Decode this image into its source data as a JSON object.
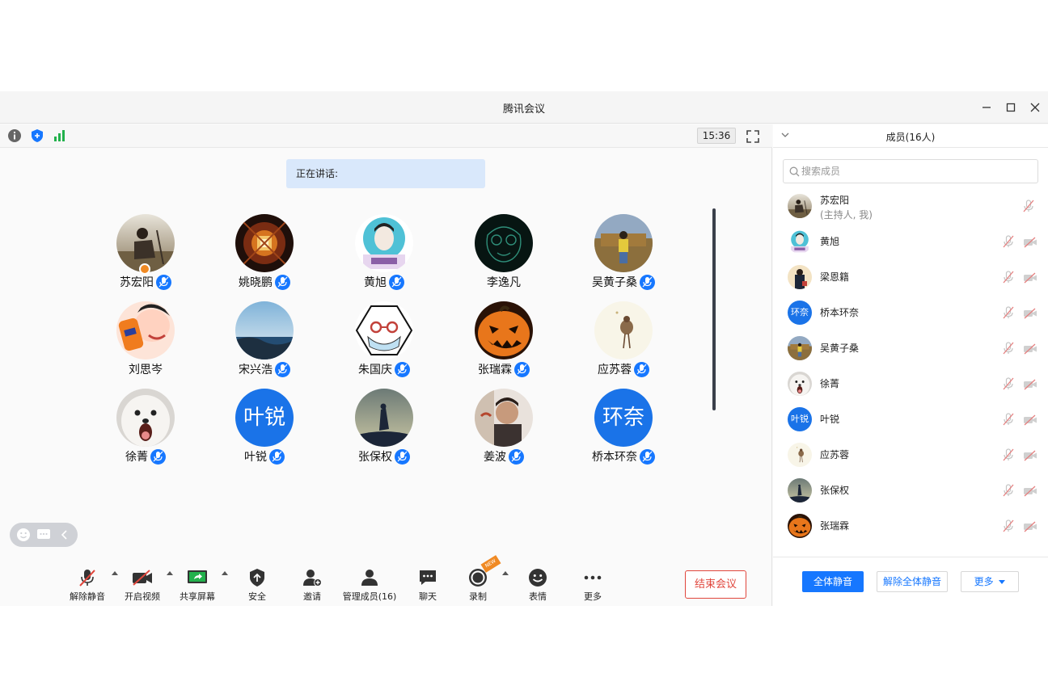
{
  "window": {
    "title": "腾讯会议"
  },
  "topbar": {
    "clock": "15:36"
  },
  "speaking": {
    "label": "正在讲话:"
  },
  "participants": [
    {
      "name": "苏宏阳"
    },
    {
      "name": "姚晓鹏"
    },
    {
      "name": "黄旭"
    },
    {
      "name": "李逸凡"
    },
    {
      "name": "吴黄子桑"
    },
    {
      "name": "刘思岑"
    },
    {
      "name": "宋兴浩"
    },
    {
      "name": "朱国庆"
    },
    {
      "name": "张瑞霖"
    },
    {
      "name": "应苏蓉"
    },
    {
      "name": "徐菁"
    },
    {
      "name": "叶锐",
      "avatar_text": "叶锐"
    },
    {
      "name": "张保权"
    },
    {
      "name": "姜波"
    },
    {
      "name": "桥本环奈",
      "avatar_text": "环奈"
    }
  ],
  "toolbar": {
    "unmute": "解除静音",
    "video": "开启视频",
    "share": "共享屏幕",
    "security": "安全",
    "invite": "邀请",
    "manage": "管理成员(16)",
    "chat": "聊天",
    "record": "录制",
    "emoji": "表情",
    "more": "更多",
    "end": "结束会议",
    "new_badge": "NEW"
  },
  "panel": {
    "title": "成员(16人)",
    "search_placeholder": "搜索成员",
    "members": [
      {
        "name": "苏宏阳",
        "sub": "(主持人, 我)"
      },
      {
        "name": "黄旭"
      },
      {
        "name": "梁恩籍"
      },
      {
        "name": "桥本环奈",
        "avatar_text": "环奈"
      },
      {
        "name": "吴黄子桑"
      },
      {
        "name": "徐菁"
      },
      {
        "name": "叶锐",
        "avatar_text": "叶锐"
      },
      {
        "name": "应苏蓉"
      },
      {
        "name": "张保权"
      },
      {
        "name": "张瑞霖"
      }
    ],
    "mute_all": "全体静音",
    "unmute_all": "解除全体静音",
    "more": "更多"
  },
  "colors": {
    "accent": "#1677ff",
    "danger": "#e0463c"
  }
}
